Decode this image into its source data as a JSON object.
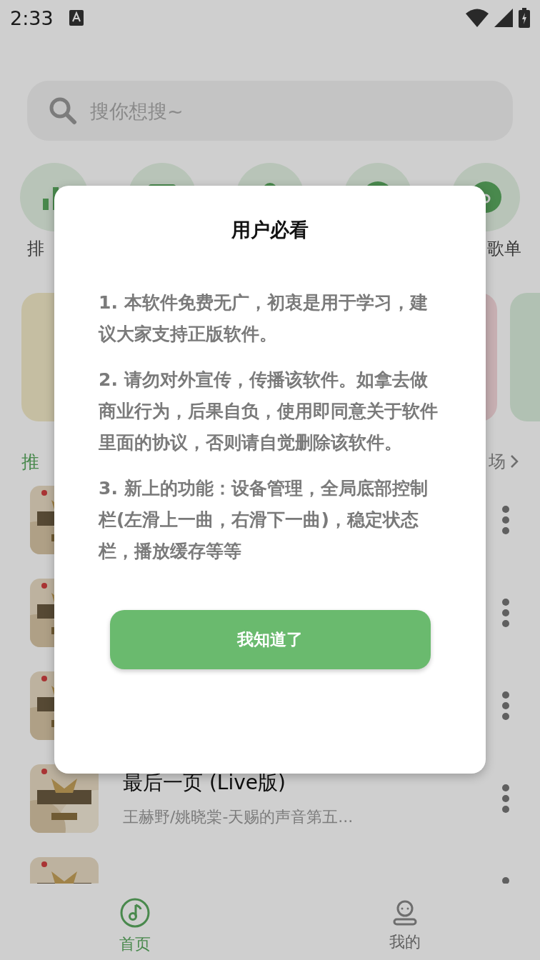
{
  "status_bar": {
    "time": "2:33"
  },
  "search": {
    "placeholder": "搜你想搜~"
  },
  "categories": [
    {
      "label": "排"
    },
    {
      "label": "歌单"
    }
  ],
  "section": {
    "title": "推",
    "more": "场"
  },
  "songs": [
    {
      "thumbnail": {
        "kind": "picture"
      }
    },
    {
      "thumbnail": {
        "kind": "picture"
      }
    },
    {
      "thumbnail": {
        "kind": "picture"
      }
    },
    {
      "thumbnail": {
        "kind": "picture"
      },
      "title": "最后一页 (Live版)",
      "subtitle": "王赫野/姚晓棠-天赐的声音第五..."
    },
    {
      "thumbnail": {
        "kind": "picture"
      }
    }
  ],
  "bottom_nav": [
    {
      "label": "首页",
      "selected": true
    },
    {
      "label": "我的",
      "selected": false
    }
  ],
  "dialog": {
    "title": "用户必看",
    "paragraphs": [
      "1. 本软件免费无广，初衷是用于学习，建议大家支持正版软件。",
      "2. 请勿对外宣传，传播该软件。如拿去做商业行为，后果自负，使用即同意关于软件里面的协议，否则请自觉删除该软件。",
      "3. 新上的功能：设备管理，全局底部控制栏(左滑上一曲，右滑下一曲)，稳定状态栏，播放缓存等等"
    ],
    "button": "我知道了"
  }
}
